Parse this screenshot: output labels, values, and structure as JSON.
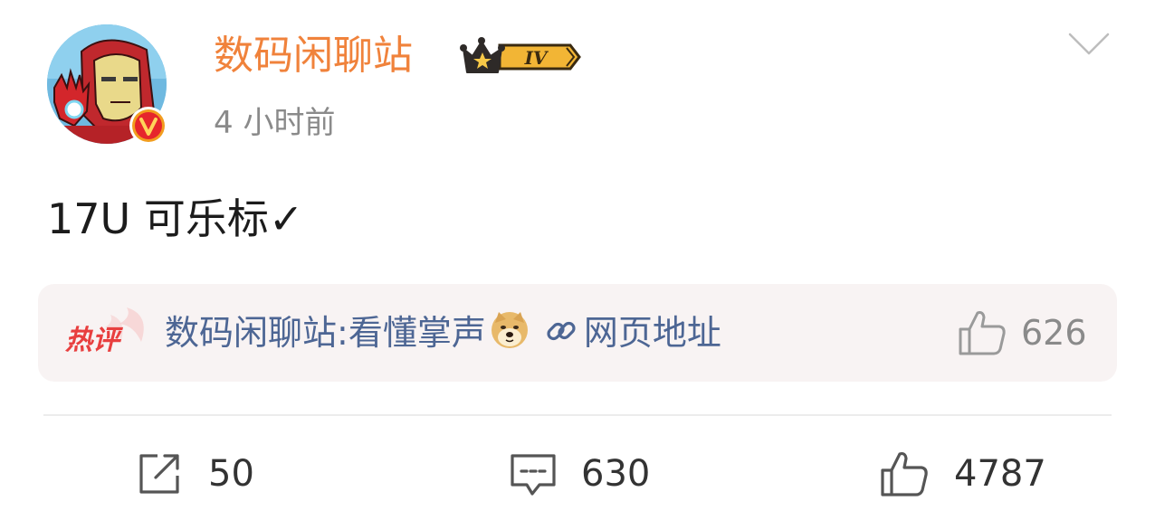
{
  "post": {
    "author": {
      "name": "数码闲聊站",
      "vip_level": "IV",
      "verified": true
    },
    "timestamp": "4 小时前",
    "text": "17U 可乐标✓"
  },
  "hot_comment": {
    "tag": "热评",
    "author": "数码闲聊站",
    "separator": ":",
    "text": "看懂掌声",
    "emoji_icon": "doge-emoji-icon",
    "link_label": "网页地址",
    "like_count": "626"
  },
  "actions": {
    "share_count": "50",
    "comment_count": "630",
    "like_count": "4787"
  },
  "colors": {
    "username": "#f0823b",
    "link_blue": "#4d6694",
    "hot_tag_red": "#e83f3f",
    "card_bg": "#f8f3f3",
    "muted": "#8a8a8a"
  }
}
